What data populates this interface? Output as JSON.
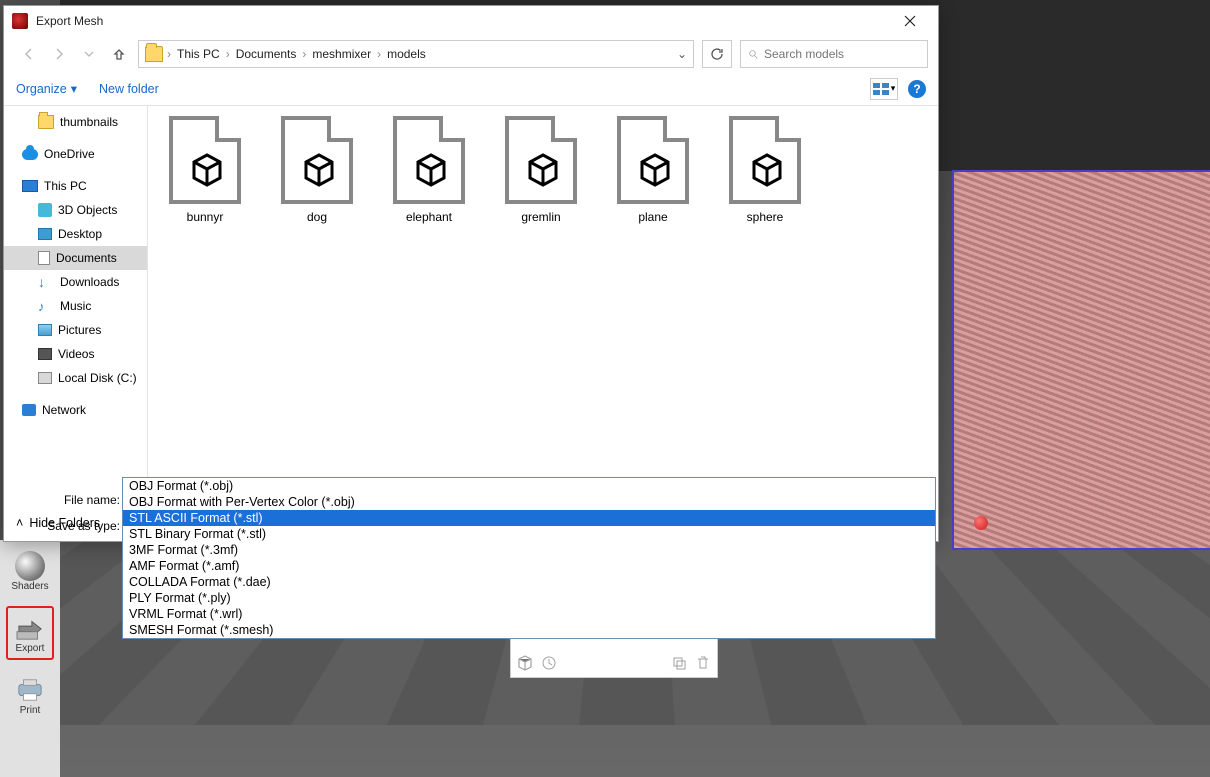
{
  "dialog": {
    "title": "Export Mesh",
    "breadcrumbs": [
      "This PC",
      "Documents",
      "meshmixer",
      "models"
    ],
    "search_placeholder": "Search models",
    "organize": "Organize",
    "new_folder": "New folder",
    "help_glyph": "?",
    "filename_label": "File name:",
    "savetype_label": "Save as type:",
    "savetype_selected": "OBJ Format (*.obj)",
    "hide_folders": "Hide Folders"
  },
  "tree": [
    {
      "name": "thumbnails",
      "icon": "folder",
      "indent": true
    },
    {
      "name": "OneDrive",
      "icon": "cloud"
    },
    {
      "name": "This PC",
      "icon": "pc"
    },
    {
      "name": "3D Objects",
      "icon": "3d",
      "indent": true
    },
    {
      "name": "Desktop",
      "icon": "desk",
      "indent": true
    },
    {
      "name": "Documents",
      "icon": "doc",
      "indent": true,
      "selected": true
    },
    {
      "name": "Downloads",
      "icon": "down",
      "indent": true
    },
    {
      "name": "Music",
      "icon": "music",
      "indent": true
    },
    {
      "name": "Pictures",
      "icon": "pic",
      "indent": true
    },
    {
      "name": "Videos",
      "icon": "vid",
      "indent": true
    },
    {
      "name": "Local Disk (C:)",
      "icon": "disk",
      "indent": true
    },
    {
      "name": "Network",
      "icon": "net"
    }
  ],
  "files": [
    "bunnyr",
    "dog",
    "elephant",
    "gremlin",
    "plane",
    "sphere"
  ],
  "formats": [
    "OBJ Format (*.obj)",
    "OBJ Format with Per-Vertex Color (*.obj)",
    "STL ASCII Format (*.stl)",
    "STL Binary Format (*.stl)",
    "3MF Format (*.3mf)",
    "AMF Format (*.amf)",
    "COLLADA Format (*.dae)",
    "PLY Format (*.ply)",
    "VRML Format (*.wrl)",
    "SMESH Format (*.smesh)"
  ],
  "formats_highlight_index": 2,
  "toolbar": {
    "shaders": "Shaders",
    "export": "Export",
    "print": "Print"
  }
}
